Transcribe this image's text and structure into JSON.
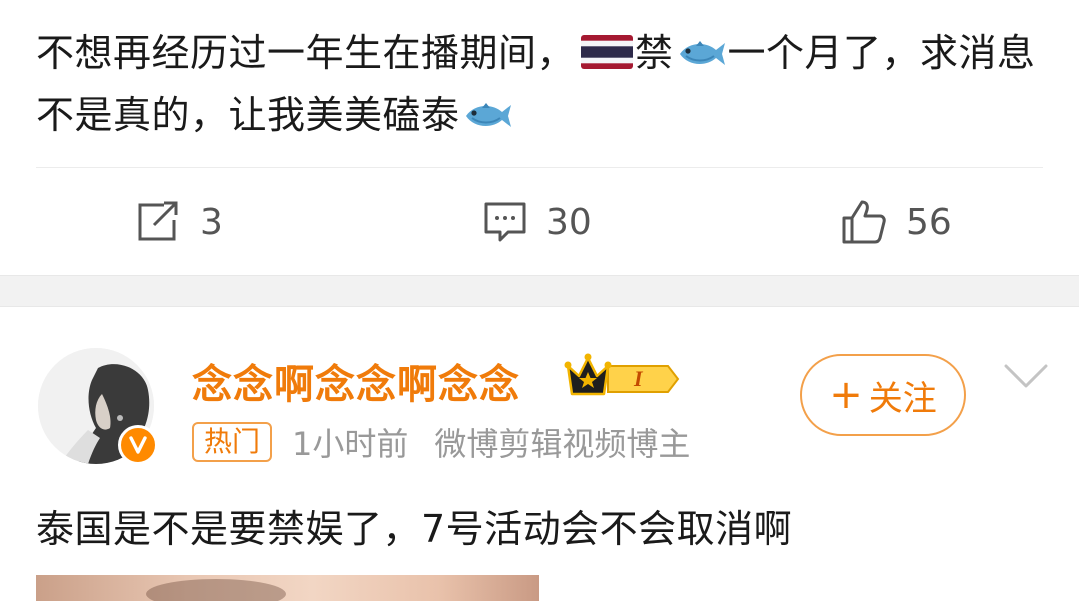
{
  "post": {
    "text_part1": "不想再经历过一年生在播期间，",
    "text_part2": "禁",
    "text_part3": "一个月了，求消息不是真的，让我美美磕泰",
    "flag_icon": "thailand-flag-icon",
    "fish_icon": "fish-emoji-icon"
  },
  "actions": {
    "repost_count": "3",
    "comment_count": "30",
    "like_count": "56"
  },
  "comment": {
    "username": "念念啊念念啊念念",
    "badge_level": "I",
    "hot_tag": "热门",
    "time": "1小时前",
    "source": "微博剪辑视频博主",
    "follow_label": "关注",
    "follow_plus": "+",
    "text": "泰国是不是要禁娱了，7号活动会不会取消啊"
  },
  "colors": {
    "accent": "#f07b0a",
    "accent_border": "#f3a04a",
    "text": "#1a1a1a",
    "muted": "#999999",
    "action_gray": "#555555",
    "section_bg": "#f2f2f2"
  }
}
